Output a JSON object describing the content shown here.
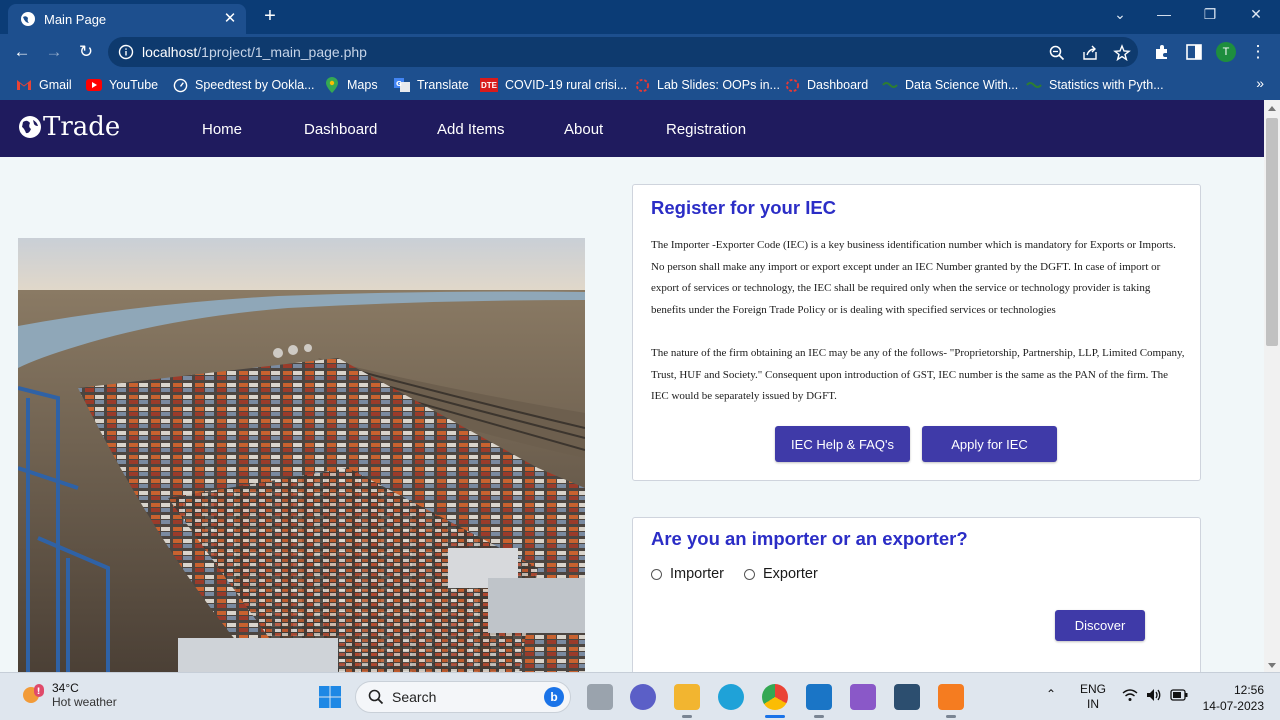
{
  "browser": {
    "tab_title": "Main Page",
    "url_host": "localhost",
    "url_path": "/1project/1_main_page.php",
    "profile_initial": "T",
    "bookmarks": [
      {
        "label": "Gmail",
        "icon": "gmail-icon"
      },
      {
        "label": "YouTube",
        "icon": "youtube-icon"
      },
      {
        "label": "Speedtest by Ookla...",
        "icon": "speedtest-icon"
      },
      {
        "label": "Maps",
        "icon": "maps-icon"
      },
      {
        "label": "Translate",
        "icon": "translate-icon"
      },
      {
        "label": "COVID-19 rural crisi...",
        "icon": "dte-icon",
        "badge": "DTE"
      },
      {
        "label": "Lab Slides: OOPs in...",
        "icon": "lab-icon"
      },
      {
        "label": "Dashboard",
        "icon": "dashboard-icon"
      },
      {
        "label": "Data Science With...",
        "icon": "ds-icon"
      },
      {
        "label": "Statistics with Pyth...",
        "icon": "stats-icon"
      }
    ]
  },
  "site": {
    "logo_text": "Trade",
    "nav": [
      "Home",
      "Dashboard",
      "Add Items",
      "About",
      "Registration"
    ]
  },
  "iec_card": {
    "title": "Register for your IEC",
    "para1": "The Importer -Exporter Code (IEC) is a key business identification number which is mandatory for Exports or Imports. No person shall make any import or export except under an IEC Number granted by the DGFT. In case of import or export of services or technology, the IEC shall be required only when the service or technology provider is taking benefits under the Foreign Trade Policy or is dealing with specified services or technologies",
    "para2": "The nature of the firm obtaining an IEC may be any of the follows- \"Proprietorship, Partnership, LLP, Limited Company, Trust, HUF and Society.\" Consequent upon introduction of GST, IEC number is the same as the PAN of the firm. The IEC would be separately issued by DGFT.",
    "help_button": "IEC Help & FAQ's",
    "apply_button": "Apply for IEC"
  },
  "role_card": {
    "title": "Are you an importer or an exporter?",
    "option1": "Importer",
    "option2": "Exporter",
    "discover_button": "Discover"
  },
  "taskbar": {
    "temp": "34°C",
    "weather": "Hot weather",
    "search_label": "Search",
    "lang1": "ENG",
    "lang2": "IN",
    "time": "12:56",
    "date": "14-07-2023"
  },
  "colors": {
    "site_nav_bg": "#1f1b5e",
    "heading": "#2b2dc6",
    "button": "#3f3aa8",
    "chrome": "#1d4f8e"
  }
}
